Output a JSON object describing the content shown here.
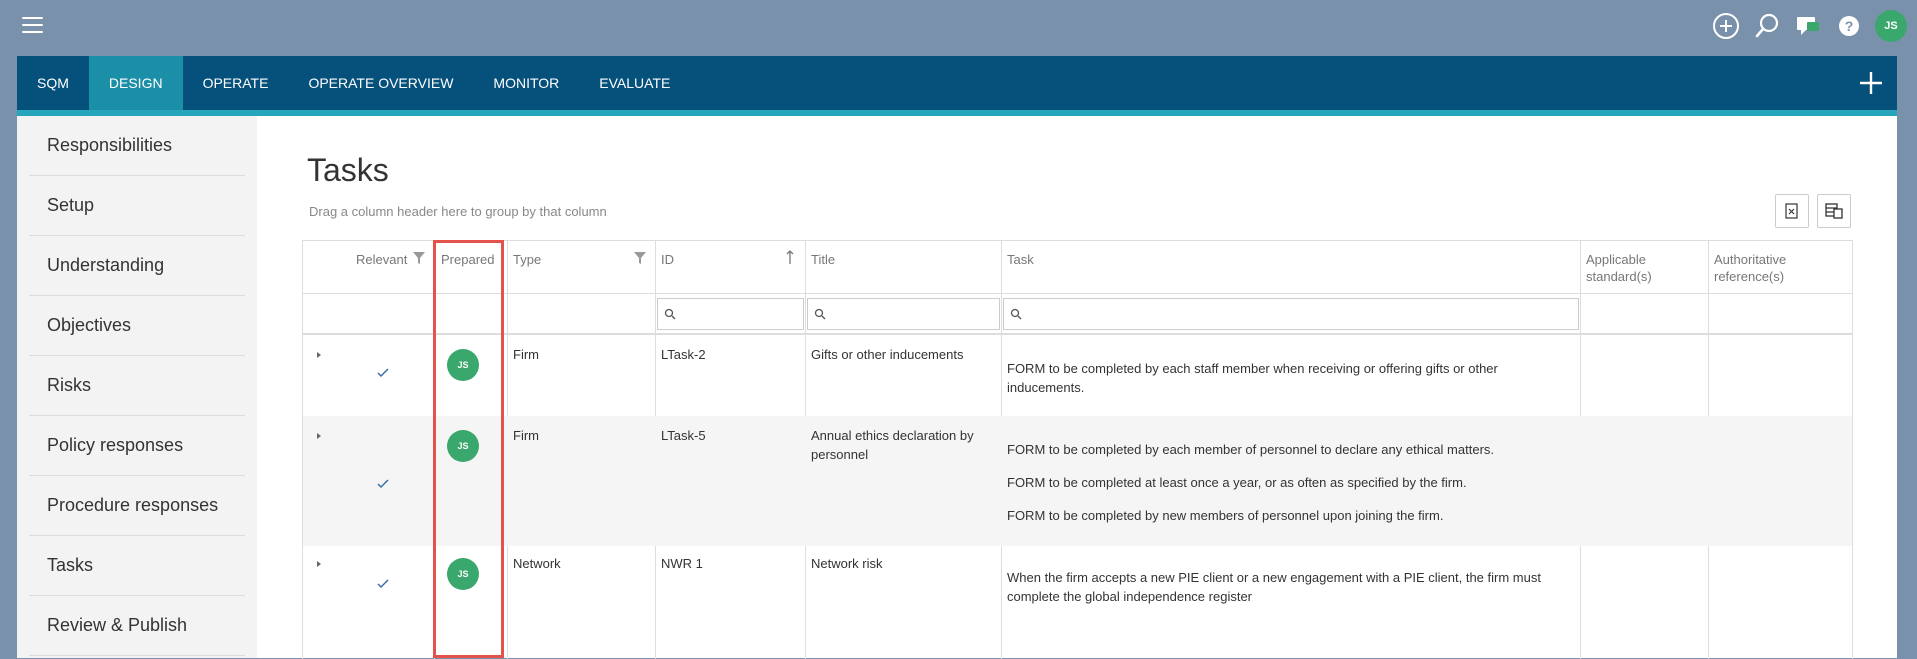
{
  "header": {
    "user_initials": "JS",
    "icons": [
      "menu-icon",
      "add-circle-icon",
      "search-icon",
      "chat-icon",
      "help-icon"
    ]
  },
  "nav": {
    "tabs": [
      {
        "label": "SQM",
        "active": false
      },
      {
        "label": "DESIGN",
        "active": true
      },
      {
        "label": "OPERATE",
        "active": false
      },
      {
        "label": "OPERATE OVERVIEW",
        "active": false
      },
      {
        "label": "MONITOR",
        "active": false
      },
      {
        "label": "EVALUATE",
        "active": false
      }
    ]
  },
  "sidebar": {
    "items": [
      {
        "label": "Responsibilities"
      },
      {
        "label": "Setup"
      },
      {
        "label": "Understanding"
      },
      {
        "label": "Objectives"
      },
      {
        "label": "Risks"
      },
      {
        "label": "Policy responses"
      },
      {
        "label": "Procedure responses"
      },
      {
        "label": "Tasks"
      },
      {
        "label": "Review & Publish"
      }
    ]
  },
  "main": {
    "title": "Tasks",
    "group_hint": "Drag a column header here to group by that column",
    "columns": {
      "relevant": "Relevant",
      "prepared": "Prepared",
      "type": "Type",
      "id": "ID",
      "title": "Title",
      "task": "Task",
      "applicable_l1": "Applicable",
      "applicable_l2": "standard(s)",
      "authoritative_l1": "Authoritative",
      "authoritative_l2": "reference(s)"
    },
    "rows": [
      {
        "prepared_initials": "JS",
        "type": "Firm",
        "id": "LTask-2",
        "title": "Gifts or other inducements",
        "task": [
          "FORM to be completed by each staff member when receiving or offering gifts or other inducements."
        ]
      },
      {
        "prepared_initials": "JS",
        "type": "Firm",
        "id": "LTask-5",
        "title": "Annual ethics declaration by personnel",
        "task": [
          "FORM to be completed by each member of personnel to declare any ethical matters.",
          "FORM to be completed at least once a year, or as often as specified by the firm.",
          "FORM to be completed by new members of personnel upon joining the firm."
        ]
      },
      {
        "prepared_initials": "JS",
        "type": "Network",
        "id": "NWR 1",
        "title": "Network risk",
        "task": [
          "When the firm accepts a new PIE client or a new engagement with a PIE client, the firm must complete the global independence register"
        ]
      }
    ]
  },
  "colors": {
    "nav_bg": "#06517c",
    "nav_active": "#1c8fa8",
    "accent_strip": "#27a6bb",
    "avatar_green": "#3aa76d",
    "highlight": "#e4534b"
  }
}
